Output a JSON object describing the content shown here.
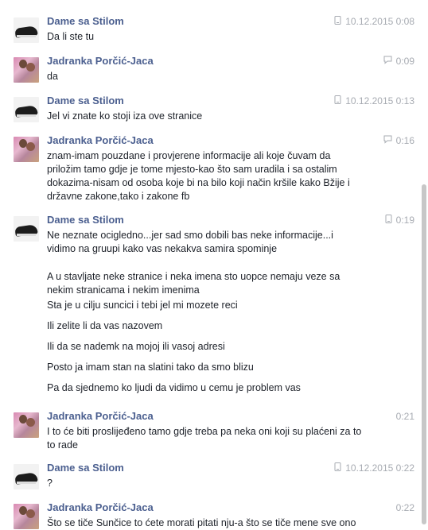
{
  "messages": [
    {
      "sender": "Dame sa Stilom",
      "avatar": "shoe-avatar",
      "meta_icon": "phone-icon",
      "meta_text": "10.12.2015 0:08",
      "paragraphs": [
        "Da li ste tu"
      ]
    },
    {
      "sender": "Jadranka Porčić-Jaca",
      "avatar": "photo-avatar",
      "meta_icon": "chat-icon",
      "meta_text": "0:09",
      "paragraphs": [
        "da"
      ]
    },
    {
      "sender": "Dame sa Stilom",
      "avatar": "shoe-avatar",
      "meta_icon": "phone-icon",
      "meta_text": "10.12.2015 0:13",
      "paragraphs": [
        "Jel vi znate ko stoji iza ove stranice"
      ]
    },
    {
      "sender": "Jadranka Porčić-Jaca",
      "avatar": "photo-avatar",
      "meta_icon": "chat-icon",
      "meta_text": "0:16",
      "paragraphs": [
        "znam-imam pouzdane i provjerene informacije ali koje čuvam da\npriložim tamo gdje je tome mjesto-kao što sam uradila i sa ostalim\ndokazima-nisam od osoba koje bi na bilo koji način kršile kako Bžije i\ndržavne zakone,tako i zakone fb"
      ]
    },
    {
      "sender": "Dame sa Stilom",
      "avatar": "shoe-avatar",
      "meta_icon": "phone-icon",
      "meta_text": "0:19",
      "paragraphs": [
        "Ne neznate ocigledno...jer sad smo dobili bas neke informacije...i\nvidimo na gruupi kako vas nekakva samira spominje",
        "A  u stavljate neke stranice i neka imena sto uopce nemaju veze sa\nnekim stranicama i nekim imenima",
        "Sta je u cilju suncici i tebi jel mi mozete reci",
        "Ili zelite li da vas nazovem",
        "Ili da se nademk na mojoj ili vasoj adresi",
        "Posto ja imam stan na slatini tako da smo blizu",
        "Pa da sjednemo ko ljudi da vidimo u cemu je problem vas"
      ]
    },
    {
      "sender": "Jadranka Porčić-Jaca",
      "avatar": "photo-avatar",
      "meta_icon": "",
      "meta_text": "0:21",
      "paragraphs": [
        "I to će biti proslijeđeno tamo gdje treba pa neka oni koji su plaćeni za to\nto rade"
      ]
    },
    {
      "sender": "Dame sa Stilom",
      "avatar": "shoe-avatar",
      "meta_icon": "phone-icon",
      "meta_text": "10.12.2015 0:22",
      "paragraphs": [
        "?"
      ]
    },
    {
      "sender": "Jadranka Porčić-Jaca",
      "avatar": "photo-avatar",
      "meta_icon": "",
      "meta_text": "0:22",
      "paragraphs": [
        "Što se tiče Sunčice to ćete morati pitati nju-a što se tiče mene sve ono"
      ]
    }
  ]
}
